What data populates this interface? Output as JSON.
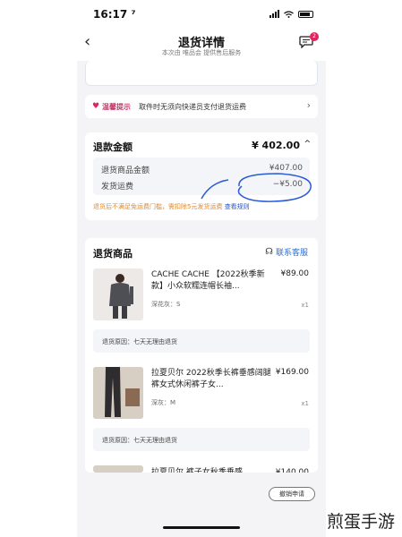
{
  "status_bar": {
    "time": "16:17 ⁷"
  },
  "nav": {
    "back_label": "‹",
    "title": "退货详情",
    "subtitle": "本次由 唯品会 提供售后服务",
    "badge_count": "2"
  },
  "tip": {
    "label": "温馨提示",
    "text": "取件时无须向快递员支付退货运费",
    "arrow": "›"
  },
  "refund": {
    "title": "退款金额",
    "amount": "¥ 402.00",
    "caret": "^",
    "rows": [
      {
        "label": "退货商品金额",
        "value": "¥407.00"
      },
      {
        "label": "发货运费",
        "value": "−¥5.00"
      }
    ],
    "note": "退货后不满足免运费门槛，需扣除5元发货运费",
    "note_link": "查看规则"
  },
  "goods": {
    "title": "退货商品",
    "customer_service": "联系客服",
    "items": [
      {
        "name": "CACHE CACHE 【2022秋季新款】小众软糯连帽长袖...",
        "price": "¥89.00",
        "spec": "深花灰：S",
        "qty": "x1",
        "reason": "退货原因：七天无理由退货"
      },
      {
        "name": "拉夏贝尔 2022秋季长裤垂感阔腿裤女式休闲裤子女...",
        "price": "¥169.00",
        "spec": "深灰：M",
        "qty": "x1",
        "reason": "退货原因：七天无理由退货"
      },
      {
        "name": "拉夏贝尔 裤子女秋季垂感...",
        "price": "¥140.00"
      }
    ]
  },
  "actions": {
    "cancel_label": "撤销申请"
  },
  "watermark": "煎蛋手游",
  "colors": {
    "accent_pink": "#e0245e",
    "link_blue": "#2b6fd6",
    "note_orange": "#e28a2c",
    "pen_annotation": "#2a5bd7"
  }
}
